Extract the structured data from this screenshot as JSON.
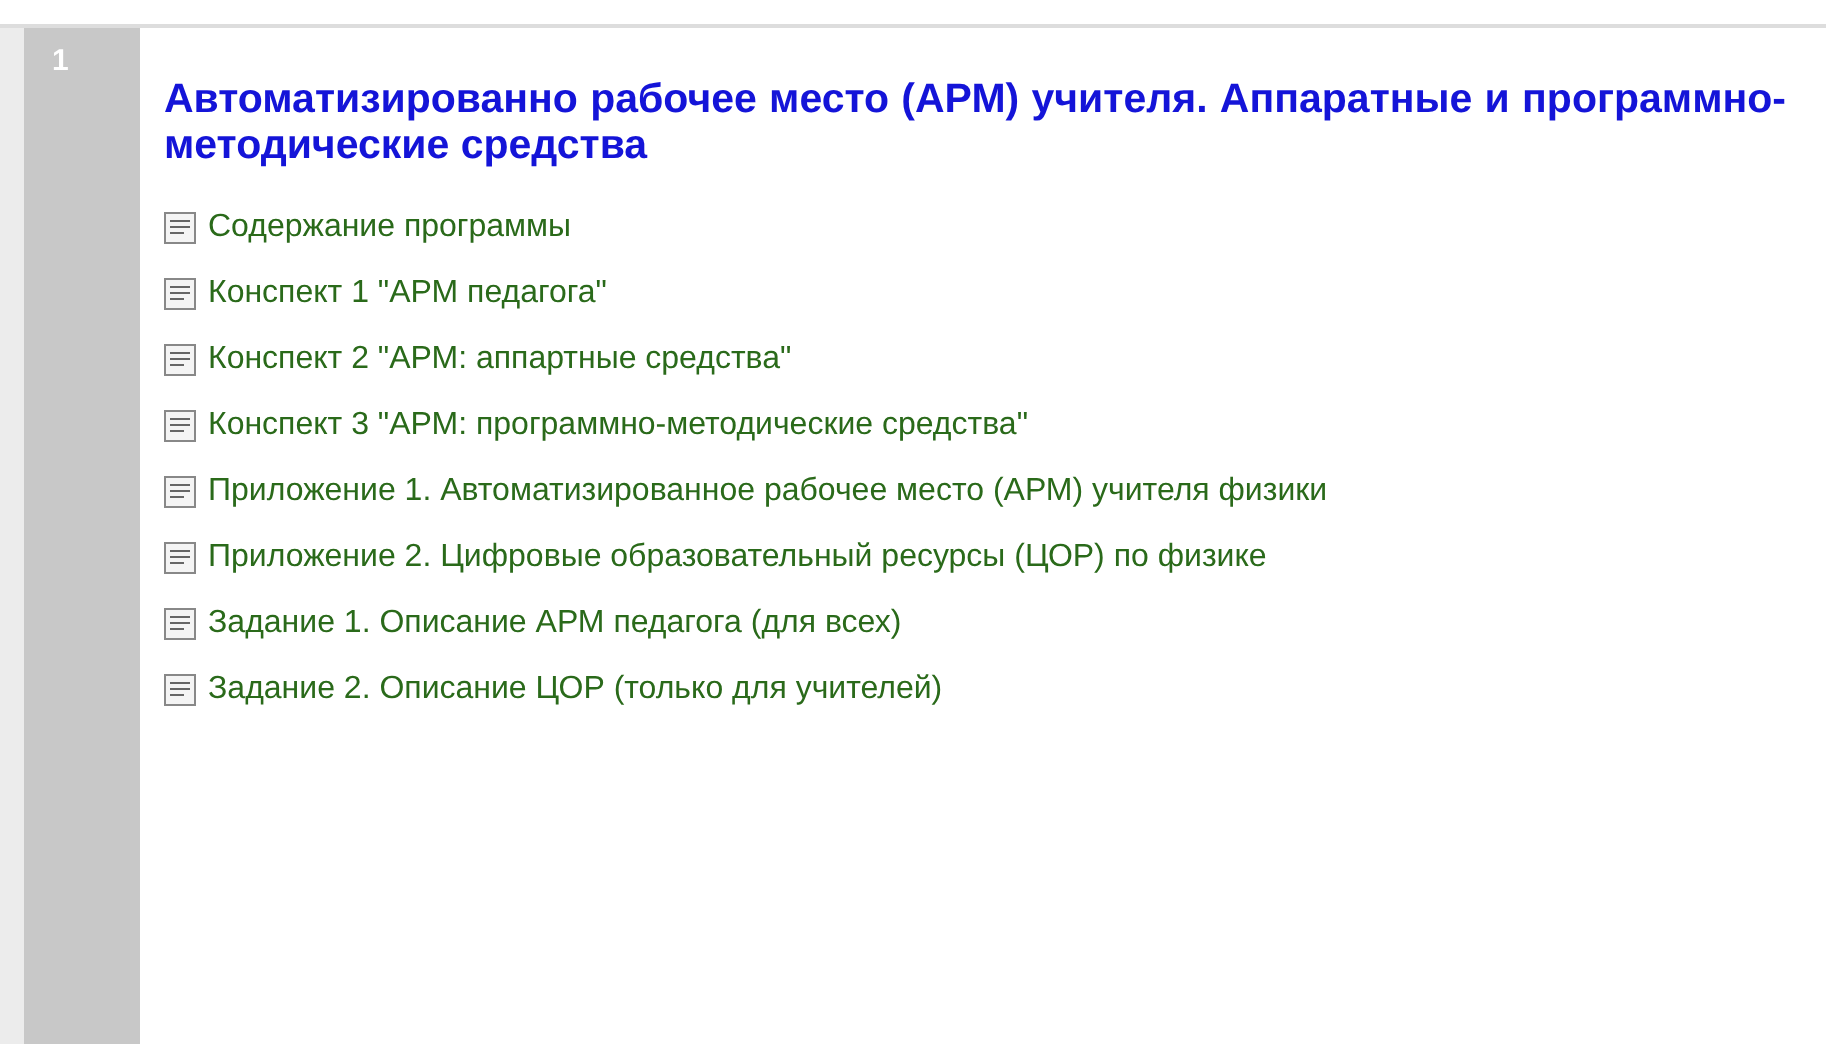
{
  "section": {
    "number": "1",
    "title": "Автоматизированно рабочее место (АРМ) учителя. Аппаратные и программно-методические средства",
    "links": [
      {
        "label": "Содержание программы"
      },
      {
        "label": "Конспект 1 \"АРМ педагога\""
      },
      {
        "label": "Конспект 2 \"АРМ: аппартные средства\""
      },
      {
        "label": "Конспект 3 \"АРМ: программно-методические средства\""
      },
      {
        "label": "Приложение 1. Автоматизированное рабочее место (АРМ) учителя физики"
      },
      {
        "label": "Приложение 2. Цифровые образовательный ресурсы (ЦОР) по физике"
      },
      {
        "label": "Задание 1. Описание АРМ педагога (для всех)"
      },
      {
        "label": "Задание 2. Описание ЦОР (только для учителей)"
      }
    ]
  }
}
